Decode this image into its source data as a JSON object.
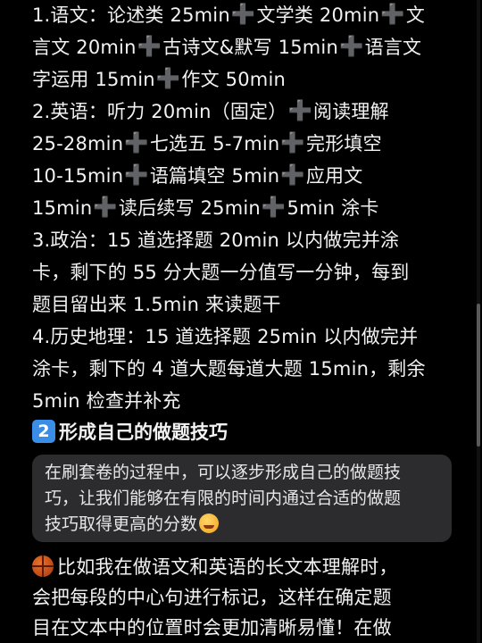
{
  "plus_symbol": "➕",
  "section1": {
    "lines": [
      [
        "1.语文：论述类 25min",
        "文学类 20min",
        "文"
      ],
      [
        "言文 20min",
        "古诗文&默写 15min",
        "语言文"
      ],
      [
        "字运用 15min",
        "作文 50min"
      ],
      [
        "2.英语：听力 20min（固定）",
        "阅读理解"
      ],
      [
        "25-28min",
        "七选五 5-7min",
        "完形填空"
      ],
      [
        "10-15min",
        "语篇填空 5min",
        "应用文"
      ],
      [
        "15min",
        "读后续写 25min",
        "5min 涂卡"
      ],
      [
        "3.政治：15 道选择题 20min 以内做完并涂"
      ],
      [
        "卡，剩下的 55 分大题一分值写一分钟，每到"
      ],
      [
        "题目留出来 1.5min 来读题干"
      ],
      [
        "4.历史地理：15 道选择题 25min 以内做完并"
      ],
      [
        "涂卡，剩下的 4 道大题每道大题 15min，剩余"
      ],
      [
        "5min 检查并补充"
      ]
    ]
  },
  "heading2": {
    "badge": "2",
    "text": "形成自己的做题技巧"
  },
  "quote": {
    "lines": [
      "在刷套卷的过程中，可以逐步形成自己的做题技",
      "巧，让我们能够在有限的时间内通过合适的做题",
      "技巧取得更高的分数"
    ]
  },
  "paragraph": {
    "lines": [
      "比如我在做语文和英语的长文本理解时，",
      "会把每段的中心句进行标记，这样在确定题",
      "目在文本中的位置时会更加清晰易懂！在做"
    ]
  },
  "colors": {
    "background": "#000000",
    "text": "#f2f2f2",
    "plus": "#9a9a9a",
    "quote_bg": "#2c2c2e",
    "badge": "#3a8ee6"
  }
}
